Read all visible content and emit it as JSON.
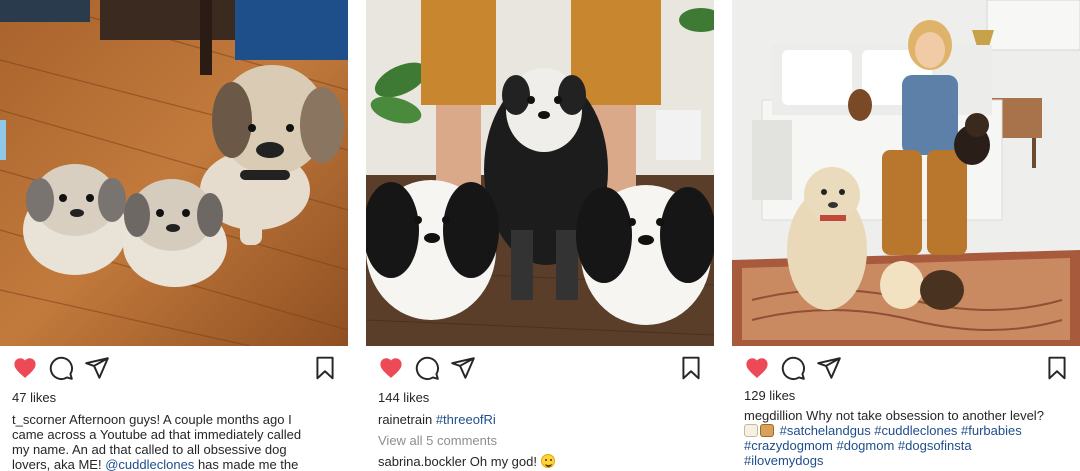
{
  "posts": [
    {
      "likes": "47 likes",
      "username": "t_scorner",
      "caption_lines": [
        "Afternoon guys! A couple months ago I",
        "came across a Youtube ad that immediately called",
        "my name. An ad that called to all obsessive dog",
        "lovers, aka ME!"
      ],
      "mention": "@cuddleclones",
      "caption_tail": "has made me the",
      "liked": true
    },
    {
      "likes": "144 likes",
      "username": "rainetrain",
      "hashtag": "#threeofRi",
      "view_comments": "View all 5 comments",
      "comment_user": "sabrina.bockler",
      "comment_text": "Oh my god!",
      "liked": true
    },
    {
      "likes": "129 likes",
      "username": "megdillion",
      "caption": "Why not take obsession to another level?",
      "hashtags_line1": "#satchelandgus #cuddleclones #furbabies",
      "hashtags_line2": "#crazydogmom #dogmom #dogsofinsta",
      "hashtags_line3": "#ilovemydogs",
      "liked": true
    }
  ],
  "colors": {
    "heart": "#ed4956",
    "text": "#262626",
    "link": "#1f4e8c",
    "muted": "#8e8e8e"
  },
  "icons": [
    "heart-icon",
    "comment-icon",
    "share-icon",
    "bookmark-icon"
  ]
}
